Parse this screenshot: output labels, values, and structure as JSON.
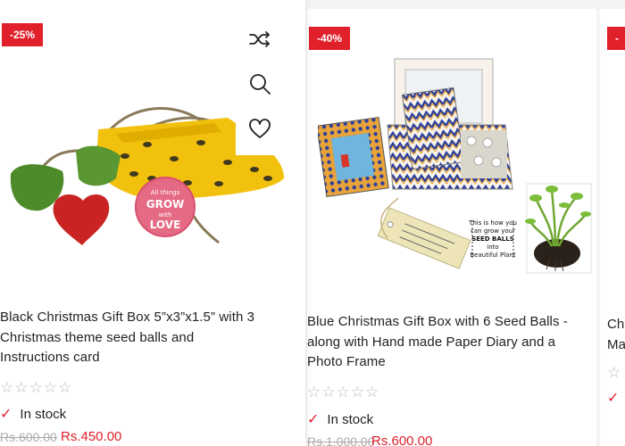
{
  "products": [
    {
      "discount_badge": "-25%",
      "title_lines": [
        "Black Christmas Gift Box 5”x3”x1.5” with 3",
        "Christmas theme seed balls and",
        "Instructions card"
      ],
      "rating_stars": "☆☆☆☆☆",
      "stock_check": "✓",
      "stock_status": "In stock",
      "old_price": "Rs.600.00",
      "new_price": "Rs.450.00",
      "image_tag_text": [
        "All things",
        "GROW",
        "with",
        "LOVE"
      ],
      "actions": [
        "shuffle-icon",
        "search-icon",
        "heart-icon"
      ]
    },
    {
      "discount_badge": "-40%",
      "title_lines": [
        "Blue Christmas Gift Box with 6 Seed Balls -",
        "along with Hand made Paper Diary and a",
        "Photo Frame"
      ],
      "rating_stars": "☆☆☆☆☆",
      "stock_check": "✓",
      "stock_status": "In stock",
      "old_price": "Rs.1,000.00",
      "new_price": "Rs.600.00",
      "image_caption_lines": [
        "This is how you",
        "can grow your",
        "SEED BALLS",
        "into",
        "Beautiful Plant"
      ]
    },
    {
      "discount_badge": "-",
      "title_lines": [
        "Ch",
        "Ma"
      ],
      "rating_stars": "☆",
      "stock_check": "✓"
    }
  ],
  "colors": {
    "sale": "#e0202a",
    "text": "#222222",
    "muted": "#aaaaaa"
  }
}
